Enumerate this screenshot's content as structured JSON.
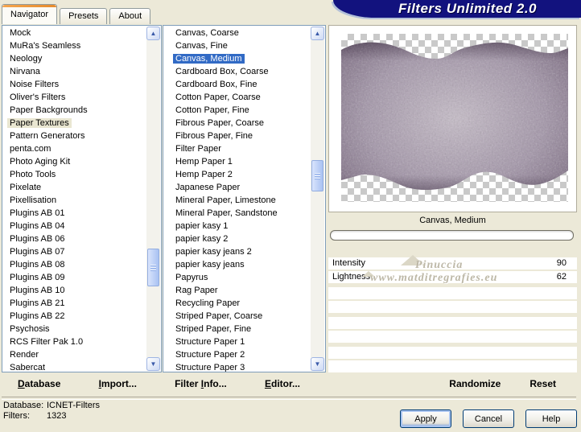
{
  "title_banner": "Filters Unlimited 2.0",
  "tabs": [
    {
      "label": "Navigator",
      "active": true
    },
    {
      "label": "Presets",
      "active": false
    },
    {
      "label": "About",
      "active": false
    }
  ],
  "category_list": {
    "selected_index": 7,
    "items": [
      "Mock",
      "MuRa's Seamless",
      "Neology",
      "Nirvana",
      "Noise Filters",
      "Oliver's Filters",
      "Paper Backgrounds",
      "Paper Textures",
      "Pattern Generators",
      "penta.com",
      "Photo Aging Kit",
      "Photo Tools",
      "Pixelate",
      "Pixellisation",
      "Plugins AB 01",
      "Plugins AB 04",
      "Plugins AB 06",
      "Plugins AB 07",
      "Plugins AB 08",
      "Plugins AB 09",
      "Plugins AB 10",
      "Plugins AB 21",
      "Plugins AB 22",
      "Psychosis",
      "RCS Filter Pak 1.0",
      "Render",
      "Sabercat"
    ]
  },
  "filter_list": {
    "selected_index": 2,
    "items": [
      "Canvas, Coarse",
      "Canvas, Fine",
      "Canvas, Medium",
      "Cardboard Box, Coarse",
      "Cardboard Box, Fine",
      "Cotton Paper, Coarse",
      "Cotton Paper, Fine",
      "Fibrous Paper, Coarse",
      "Fibrous Paper, Fine",
      "Filter Paper",
      "Hemp Paper 1",
      "Hemp Paper 2",
      "Japanese Paper",
      "Mineral Paper, Limestone",
      "Mineral Paper, Sandstone",
      "papier kasy 1",
      "papier kasy 2",
      "papier kasy jeans 2",
      "papier kasy jeans",
      "Papyrus",
      "Rag Paper",
      "Recycling Paper",
      "Striped Paper, Coarse",
      "Striped Paper, Fine",
      "Structure Paper 1",
      "Structure Paper 2",
      "Structure Paper 3"
    ]
  },
  "toolbar": {
    "items": [
      {
        "name": "database-button",
        "label": "Database",
        "key_index": 0
      },
      {
        "name": "import-button",
        "label": "Import...",
        "key_index": 0
      },
      {
        "name": "filter-info-button",
        "label": "Filter Info...",
        "key_index": 7
      },
      {
        "name": "editor-button",
        "label": "Editor...",
        "key_index": 0
      }
    ]
  },
  "preview": {
    "caption": "Canvas, Medium",
    "progress_percent": 0,
    "watermark_line1": "Pinuccia",
    "watermark_line2": "www.matditregrafies.eu"
  },
  "parameters": {
    "rows": [
      {
        "label": "Intensity",
        "value": "90"
      },
      {
        "label": "Lightness",
        "value": "62"
      }
    ],
    "empty_row_count": 6,
    "randomize_label": "Randomize",
    "reset_label": "Reset"
  },
  "status": {
    "database_label": "Database:",
    "database_value": "ICNET-Filters",
    "filters_label": "Filters:",
    "filters_value": "1323"
  },
  "action_buttons": [
    {
      "name": "apply-button",
      "label": "Apply",
      "default": true
    },
    {
      "name": "cancel-button",
      "label": "Cancel",
      "default": false
    },
    {
      "name": "help-button",
      "label": "Help",
      "default": false
    }
  ],
  "icons": {
    "scroll_up": "▲",
    "scroll_down": "▼"
  },
  "colors": {
    "dialog_bg": "#ece9d8",
    "selection_blue": "#316ac5",
    "category_selection": "#e9e6d1",
    "banner_navy": "#12127e",
    "texture_center": "#c6bcc8",
    "texture_edge": "#6e5c74",
    "tab_accent_orange": "#e68b2c"
  }
}
